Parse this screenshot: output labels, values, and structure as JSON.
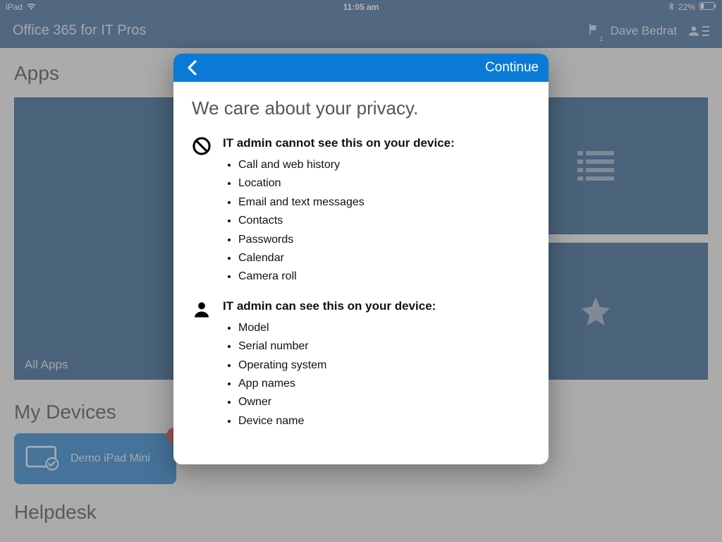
{
  "status": {
    "device": "iPad",
    "time": "11:05 am",
    "battery_pct": "22%"
  },
  "header": {
    "title": "Office 365 for IT Pros",
    "user_name": "Dave Bedrat",
    "flag_count": "1"
  },
  "sections": {
    "apps_title": "Apps",
    "my_devices_title": "My Devices",
    "helpdesk_title": "Helpdesk"
  },
  "tiles": {
    "all_apps": "All Apps"
  },
  "device": {
    "name": "Demo iPad Mini",
    "alert": "!"
  },
  "modal": {
    "continue": "Continue",
    "title": "We care about your privacy.",
    "cannot_heading": "IT admin cannot see this on your device:",
    "cannot_items": [
      "Call and web history",
      "Location",
      "Email and text messages",
      "Contacts",
      "Passwords",
      "Calendar",
      "Camera roll"
    ],
    "can_heading": "IT admin can see this on your device:",
    "can_items": [
      "Model",
      "Serial number",
      "Operating system",
      "App names",
      "Owner",
      "Device name"
    ]
  }
}
